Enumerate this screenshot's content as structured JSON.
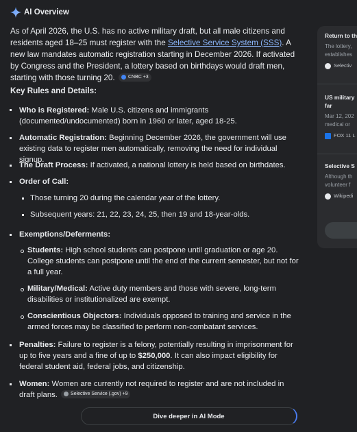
{
  "header": {
    "title": "AI Overview",
    "icon": "sparkle-icon"
  },
  "intro": {
    "text1": "As of April 2026, the U.S. has no active military draft, but all male citizens and residents aged 18–25 must register with the ",
    "link": "Selective Service System (SSS)",
    "text2": ". A new law mandates automatic registration starting in December 2026. If activated by Congress and the President, a lottery based on birthdays would draft men, starting with those turning 20.",
    "chip": "CNBC +3"
  },
  "key_rules_heading": "Key Rules and Details:",
  "items": {
    "registered": {
      "label": "Who is Registered:",
      "text": " Male U.S. citizens and immigrants (documented/undocumented) born in 1960 or later, aged 18-25."
    },
    "auto": {
      "label": "Automatic Registration:",
      "text": " Beginning December 2026, the government will use existing data to register men automatically, removing the need for individual signup."
    },
    "process": {
      "label": "The Draft Process:",
      "text": " If activated, a national lottery is held based on birthdates."
    },
    "order": {
      "label": "Order of Call:",
      "sub1": "Those turning 20 during the calendar year of the lottery.",
      "sub2": "Subsequent years: 21, 22, 23, 24, 25, then 19 and 18-year-olds."
    },
    "exemptions": {
      "label": "Exemptions/Deferments:",
      "students": {
        "label": "Students:",
        "text": " High school students can postpone until graduation or age 20. College students can postpone until the end of the current semester, but not for a full year."
      },
      "military": {
        "label": "Military/Medical:",
        "text": " Active duty members and those with severe, long-term disabilities or institutionalized are exempt."
      },
      "objectors": {
        "label": "Conscientious Objectors:",
        "text": " Individuals opposed to training and service in the armed forces may be classified to perform non-combatant services."
      }
    },
    "penalties": {
      "label": "Penalties:",
      "text1": " Failure to register is a felony, potentially resulting in imprisonment for up to five years and a fine of up to ",
      "amount": "$250,000",
      "text2": ". It can also impact eligibility for federal student aid, federal jobs, and citizenship."
    },
    "women": {
      "label": "Women:",
      "text": " Women are currently not required to register and are not included in draft plans.",
      "chip": "Selective Service (.gov) +9"
    }
  },
  "dive_button": "Dive deeper in AI Mode",
  "sidebar": {
    "card1": {
      "title": "Return to th",
      "line1": "The lottery,",
      "line2": "establishes",
      "source": "Selectiv"
    },
    "card2": {
      "title1": "US military",
      "title2": "far",
      "line1": "Mar 12, 202",
      "line2": "medical or",
      "source": "FOX 11 L"
    },
    "card3": {
      "title": "Selective S",
      "line1": "Although th",
      "line2": "volunteer f",
      "source": "Wikipedi"
    }
  },
  "colors": {
    "background": "#202124",
    "link": "#8ab4f8",
    "panel": "#2b2c2f",
    "accent": "#4a7cf0"
  }
}
